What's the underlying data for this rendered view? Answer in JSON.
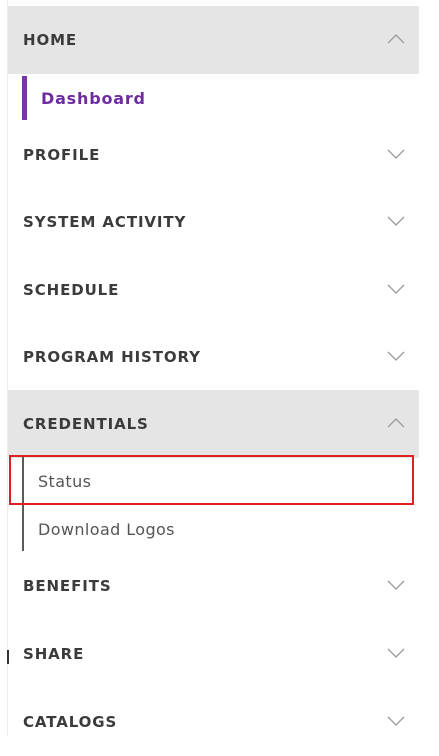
{
  "nav": {
    "sections": [
      {
        "id": "home",
        "label": "HOME",
        "expanded": true,
        "icon": "chevron-up-icon"
      },
      {
        "id": "profile",
        "label": "PROFILE",
        "expanded": false,
        "icon": "chevron-down-icon"
      },
      {
        "id": "system-activity",
        "label": "SYSTEM ACTIVITY",
        "expanded": false,
        "icon": "chevron-down-icon"
      },
      {
        "id": "schedule",
        "label": "SCHEDULE",
        "expanded": false,
        "icon": "chevron-down-icon"
      },
      {
        "id": "program-history",
        "label": "PROGRAM HISTORY",
        "expanded": false,
        "icon": "chevron-down-icon"
      },
      {
        "id": "credentials",
        "label": "CREDENTIALS",
        "expanded": true,
        "icon": "chevron-up-icon"
      },
      {
        "id": "benefits",
        "label": "BENEFITS",
        "expanded": false,
        "icon": "chevron-down-icon"
      },
      {
        "id": "share",
        "label": "SHARE",
        "expanded": false,
        "icon": "chevron-down-icon"
      },
      {
        "id": "catalogs",
        "label": "CATALOGS",
        "expanded": false,
        "icon": "chevron-down-icon"
      }
    ],
    "home_items": [
      {
        "label": "Dashboard",
        "active": true
      }
    ],
    "credentials_items": [
      {
        "label": "Status",
        "highlighted": true
      },
      {
        "label": "Download Logos",
        "highlighted": false
      }
    ]
  },
  "colors": {
    "active_accent": "#7a35a8",
    "expanded_bg": "#e5e5e5",
    "highlight_border": "#e02020"
  }
}
